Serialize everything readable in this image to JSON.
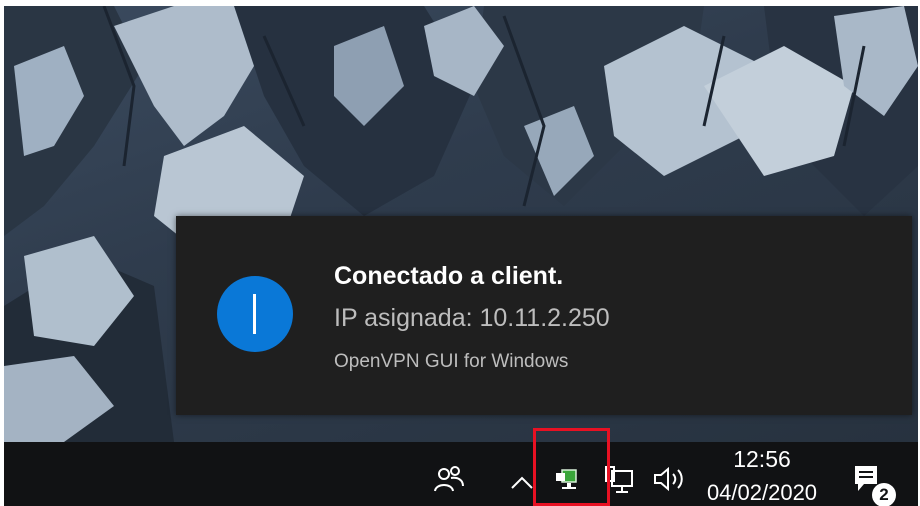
{
  "notification": {
    "title": "Conectado a client.",
    "body": "IP asignada: 10.11.2.250",
    "source": "OpenVPN GUI for Windows",
    "icon": "info-icon",
    "accent_color": "#0a78d7"
  },
  "taskbar": {
    "icons": [
      "people-icon",
      "chevron-up-icon",
      "openvpn-connected-icon",
      "network-icon",
      "volume-icon",
      "action-center-icon"
    ],
    "clock": {
      "time": "12:56",
      "date": "04/02/2020"
    },
    "action_center_badge": "2",
    "highlight_color": "#e81123"
  }
}
